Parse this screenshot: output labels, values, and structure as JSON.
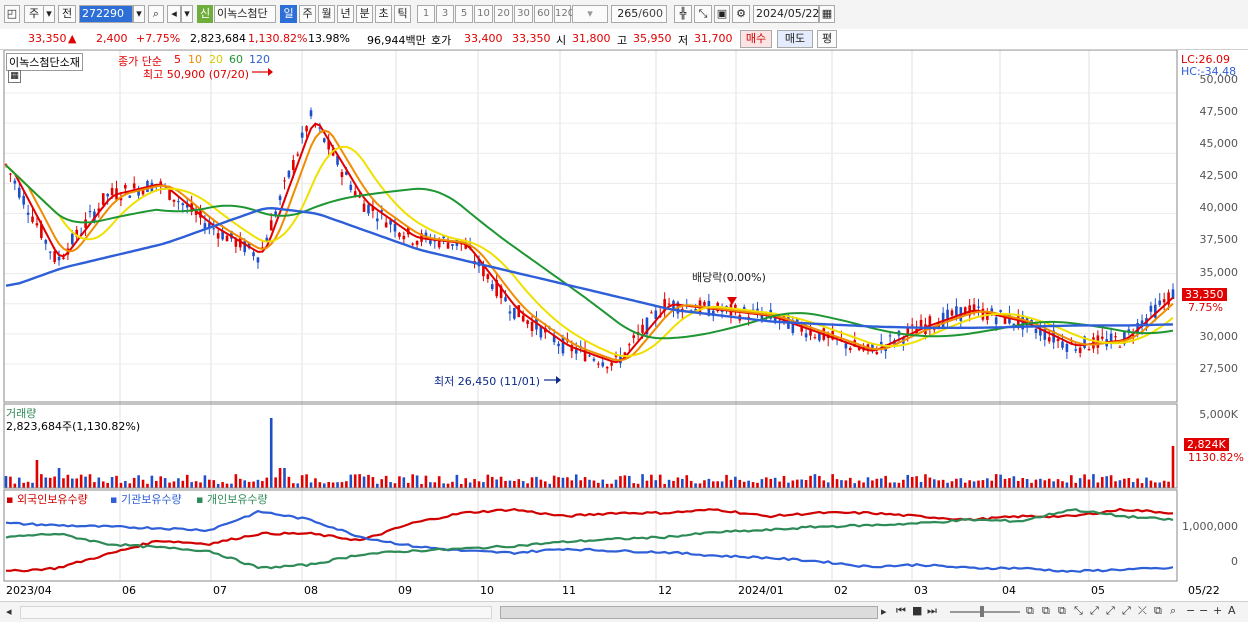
{
  "toolbar": {
    "mode_btn": "주",
    "prev_btn": "전",
    "code": "272290",
    "shin_tag": "신",
    "stock_name": "이녹스첨단",
    "periods": [
      "일",
      "주",
      "월",
      "년",
      "분",
      "초",
      "틱"
    ],
    "active_period": "일",
    "nums": [
      "1",
      "3",
      "5",
      "10",
      "20",
      "30",
      "60",
      "120"
    ],
    "count": "265",
    "count_total": "/600",
    "date": "2024/05/22"
  },
  "info": {
    "price": "33,350",
    "change": "2,400",
    "change_pct": "+7.75%",
    "volume": "2,823,684",
    "vol_pct": "1,130.82%",
    "turnover": "13.98%",
    "amount": "96,944백만",
    "ask_label": "호가",
    "ask": "33,400",
    "bid": "33,350",
    "open_label": "시",
    "open": "31,800",
    "high_label": "고",
    "high": "35,950",
    "low_label": "저",
    "low": "31,700",
    "buy_btn": "매수",
    "sell_btn": "매도",
    "eval_btn": "평"
  },
  "chart": {
    "title": "이녹스첨단소재",
    "ma_label": "종가 단순",
    "ma_periods": [
      "5",
      "10",
      "20",
      "60",
      "120"
    ],
    "ma_colors": [
      "#e00000",
      "#f08c00",
      "#f0e000",
      "#1e9632",
      "#2e5fd8"
    ],
    "high_note": "최고 50,900 (07/20)",
    "low_note": "최저 26,450 (11/01)",
    "dividend_note": "배당락(0.00%)",
    "lc": "LC:26.09",
    "hc": "HC:-34.48",
    "price_tag": "33,350",
    "price_tag_pct": "7.75%",
    "y_ticks": [
      "50,000",
      "47,500",
      "45,000",
      "42,500",
      "40,000",
      "37,500",
      "35,000",
      "32,500",
      "30,000",
      "27,500"
    ],
    "vol_title": "거래량",
    "vol_text": "2,823,684주(1,130.82%)",
    "vol_axis": "5,000K",
    "vol_tag": "2,824K",
    "vol_tag_pct": "1130.82%",
    "hold_legend": [
      "외국인보유수량",
      "기관보유수량",
      "개인보유수량"
    ],
    "hold_colors": [
      "#d00000",
      "#2e5fd8",
      "#2e8b57"
    ],
    "hold_axis": [
      "1,000,000",
      "0"
    ],
    "x_labels": [
      "2023/04",
      "06",
      "07",
      "08",
      "09",
      "10",
      "11",
      "12",
      "2024/01",
      "02",
      "03",
      "04",
      "05",
      "05/22"
    ]
  },
  "chart_data": {
    "type": "line",
    "title": "이녹스첨단소재",
    "series": [
      {
        "name": "종가 단순 5",
        "values": [
          44000,
          36000,
          41500,
          42500,
          39000,
          36500,
          48000,
          41000,
          38000,
          37500,
          32000,
          29000,
          27500,
          32500,
          32000,
          31500,
          30000,
          28500,
          30500,
          32000,
          31000,
          29000,
          29500,
          33350
        ]
      },
      {
        "name": "종가 단순 120",
        "values": [
          34000,
          35500,
          36500,
          37500,
          39000,
          40500,
          40000,
          38500,
          37000,
          36000,
          35000,
          34000,
          33000,
          32000,
          31500,
          31000,
          30800,
          30600,
          30500,
          30500,
          30600,
          30700,
          30700,
          30800
        ]
      }
    ],
    "x": [
      "2023/04",
      "05",
      "06",
      "06b",
      "07",
      "07b",
      "08",
      "08b",
      "09",
      "09b",
      "10",
      "10b",
      "11",
      "11b",
      "12",
      "12b",
      "2024/01",
      "01b",
      "02",
      "02b",
      "03",
      "03b",
      "04",
      "05/22"
    ],
    "ylim": [
      26000,
      51500
    ],
    "grid": true
  }
}
